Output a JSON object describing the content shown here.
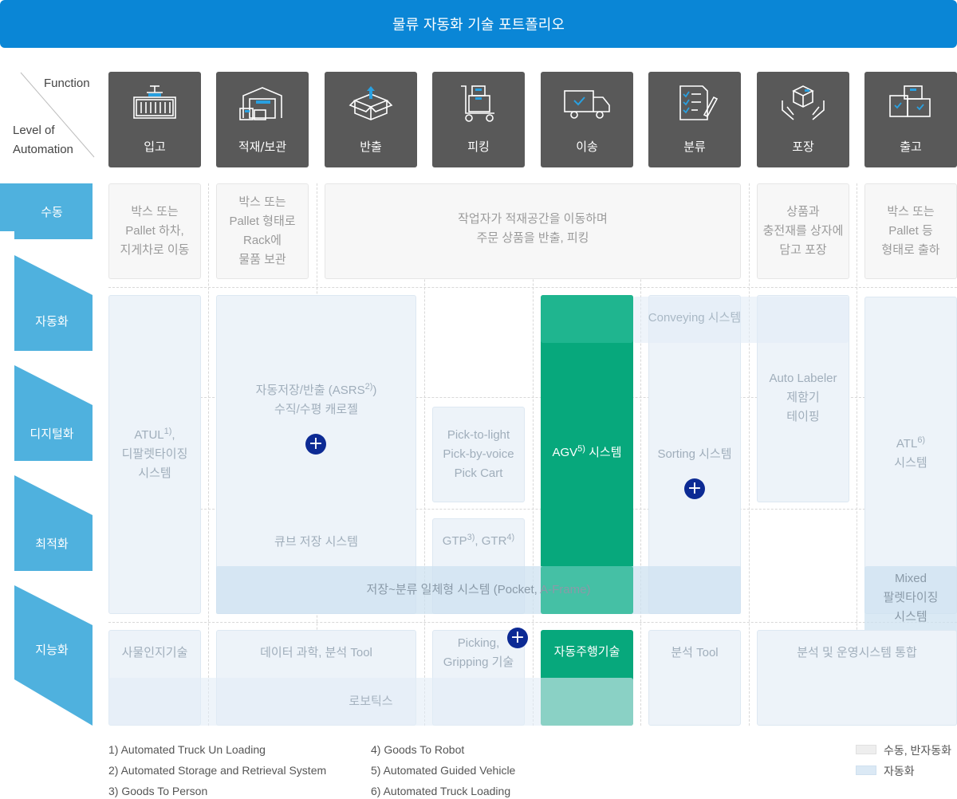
{
  "title": "물류 자동화 기술 포트폴리오",
  "corner": {
    "function_label": "Function",
    "level_label_1": "Level of",
    "level_label_2": "Automation"
  },
  "functions": [
    {
      "label": "입고",
      "icon": "container-crane-icon"
    },
    {
      "label": "적재/보관",
      "icon": "warehouse-icon"
    },
    {
      "label": "반출",
      "icon": "open-box-icon"
    },
    {
      "label": "피킹",
      "icon": "hand-cart-icon"
    },
    {
      "label": "이송",
      "icon": "truck-icon"
    },
    {
      "label": "분류",
      "icon": "checklist-icon"
    },
    {
      "label": "포장",
      "icon": "package-hands-icon"
    },
    {
      "label": "출고",
      "icon": "boxes-icon"
    }
  ],
  "levels": [
    {
      "label": "수동"
    },
    {
      "label": "자동화"
    },
    {
      "label": "디지털화"
    },
    {
      "label": "최적화"
    },
    {
      "label": "지능화"
    }
  ],
  "manual": {
    "inbound": [
      "박스 또는",
      "Pallet 하차,",
      "지게차로 이동"
    ],
    "storage": [
      "박스 또는",
      "Pallet 형태로",
      "Rack에",
      "물품 보관"
    ],
    "picking": [
      "작업자가 적재공간을 이동하며",
      "주문 상품을 반출, 피킹"
    ],
    "packing": [
      "상품과",
      "충전재를 상자에",
      "담고 포장"
    ],
    "outbound": [
      "박스 또는",
      "Pallet 등",
      "형태로 출하"
    ]
  },
  "auto": {
    "atul": {
      "name": "ATUL",
      "sup": "1)",
      "suffix": ",",
      "line2": "디팔렛타이징",
      "line3": "시스템"
    },
    "asrs": {
      "prefix": "자동저장/반출 (ASRS",
      "sup": "2)",
      "suffix": ")",
      "line2": "수직/수평 캐로젤"
    },
    "cube": "큐브 저장 시스템",
    "pick_light": [
      "Pick-to-light",
      "Pick-by-voice",
      "Pick Cart"
    ],
    "gtp": {
      "a": "GTP",
      "a_sup": "3)",
      "mid": ", GTR",
      "b_sup": "4)"
    },
    "agv": {
      "name": "AGV",
      "sup": "5)",
      "suffix": " 시스템"
    },
    "sorting": "Sorting 시스템",
    "conveying": "Conveying 시스템",
    "labeler": [
      "Auto Labeler",
      "제함기",
      "테이핑"
    ],
    "atl": {
      "name": "ATL",
      "sup": "6)",
      "line2": "시스템"
    },
    "pocket": "저장~분류 일체형 시스템 (Pocket, A-Frame)",
    "mixed": [
      "Mixed",
      "팔렛타이징",
      "시스템"
    ]
  },
  "intelligent": {
    "iot": "사물인지기술",
    "data": "데이터 과학, 분석 Tool",
    "gripping": [
      "Picking,",
      "Gripping 기술"
    ],
    "driving": "자동주행기술",
    "analysis": "분석 Tool",
    "integration": "분석 및 운영시스템 통합",
    "robotics": "로보틱스"
  },
  "plus_symbol": "+",
  "footnotes": [
    "1) Automated Truck Un Loading",
    "2) Automated Storage and Retrieval System",
    "3) Goods To Person",
    "4) Goods To Robot",
    "5) Automated Guided Vehicle",
    "6) Automated Truck Loading"
  ],
  "legend": [
    {
      "label": "수동, 반자동화",
      "color": "#eeeeee"
    },
    {
      "label": "자동화",
      "color": "#dbe9f5"
    }
  ],
  "colors": {
    "accent_blue": "#0a86d6",
    "level_tab": "#4fb1de",
    "green": "#07a87c",
    "plus": "#0c2a94",
    "card": "#595959"
  }
}
